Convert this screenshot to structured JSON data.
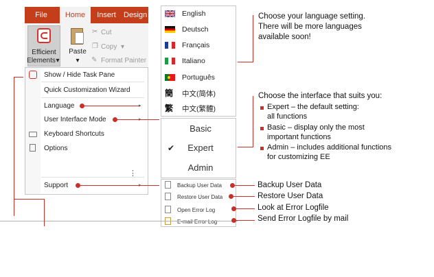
{
  "ribbon": {
    "tabs": [
      "File",
      "Home",
      "Insert",
      "Design"
    ],
    "ee_button_line1": "Efficient",
    "ee_button_line2": "Elements",
    "ee_dropdown_arrow": "▾",
    "paste_label": "Paste",
    "cut_label": "Cut",
    "copy_label": "Copy",
    "copy_arrow": "▾",
    "format_painter_label": "Format Painter"
  },
  "menu": {
    "items": [
      {
        "label": "Show / Hide Task Pane"
      },
      {
        "label": "Quick Customization Wizard"
      },
      {
        "label": "Language",
        "submenu": "▸"
      },
      {
        "label": "User Interface Mode",
        "submenu": "▸"
      },
      {
        "label": "Keyboard Shortcuts"
      },
      {
        "label": "Options"
      },
      {
        "label": "Support",
        "submenu": "▸"
      }
    ],
    "more_dots": "⋮"
  },
  "languages": [
    {
      "label": "English",
      "icon": "uk-flag-icon"
    },
    {
      "label": "Deutsch",
      "icon": "germany-flag-icon"
    },
    {
      "label": "Français",
      "icon": "france-flag-icon"
    },
    {
      "label": "Italiano",
      "icon": "italy-flag-icon"
    },
    {
      "label": "Português",
      "icon": "portugal-flag-icon"
    },
    {
      "label": "中文(简体)",
      "icon": "simplified-chinese-icon",
      "glyph": "簡"
    },
    {
      "label": "中文(繁體)",
      "icon": "traditional-chinese-icon",
      "glyph": "繁"
    }
  ],
  "modes": {
    "items": [
      "Basic",
      "Expert",
      "Admin"
    ],
    "selected": "Expert",
    "check": "✔"
  },
  "support": [
    {
      "label": "Backup User Data"
    },
    {
      "label": "Restore User Data"
    },
    {
      "label": "Open Error Log"
    },
    {
      "label": "E-mail Error Log"
    }
  ],
  "annotations": {
    "language_line1": "Choose your language setting.",
    "language_line2": "There will be more languages",
    "language_line3": "available soon!",
    "mode_title": "Choose the interface that suits you:",
    "mode_bullets": [
      {
        "line1": "Expert – the default setting:",
        "line2": "all functions"
      },
      {
        "line1": "Basic – display only the most",
        "line2": "important functions"
      },
      {
        "line1": "Admin – includes additional functions",
        "line2": "for customizing EE"
      }
    ],
    "support_lines": [
      "Backup User Data",
      "Restore User Data",
      "Look at Error Logfile",
      "Send Error Logfile by mail"
    ]
  },
  "colors": {
    "accent": "#c8302a",
    "ribbon": "#c43e1c"
  }
}
